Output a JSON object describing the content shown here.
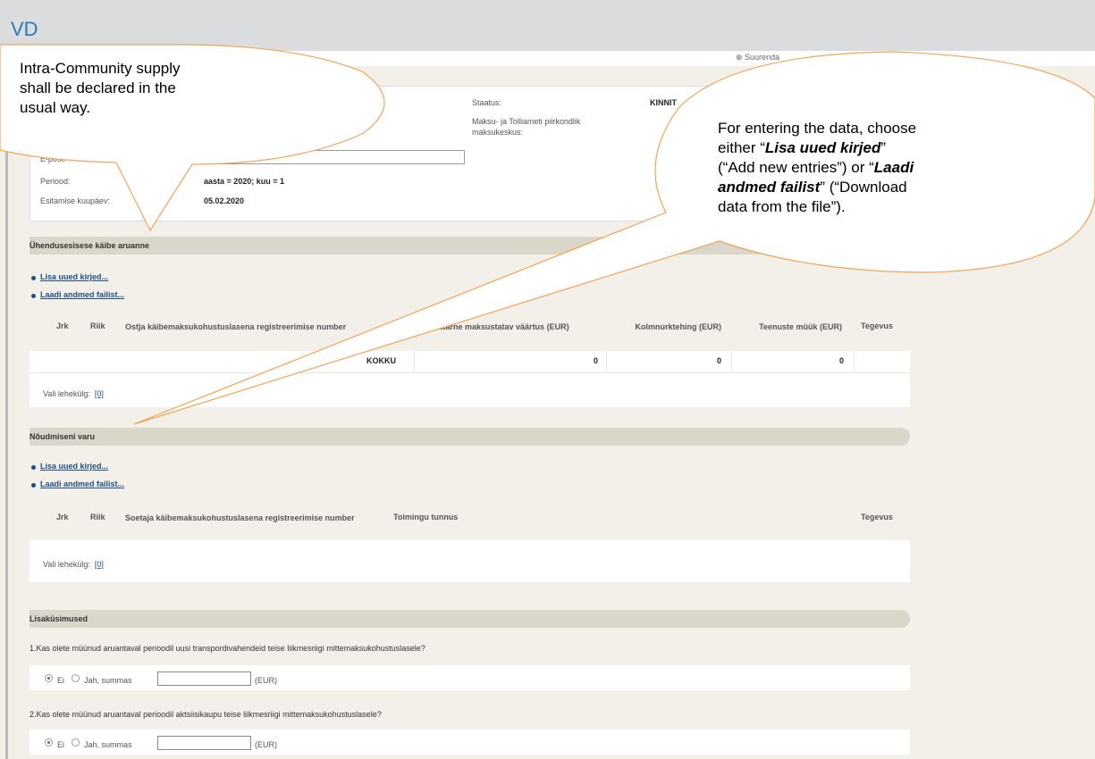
{
  "app": {
    "title": "VD",
    "zoom_label": "Suurenda"
  },
  "info": {
    "status_label": "Staatus:",
    "status_value": "KINNIT",
    "office_label": "Maksu- ja Tolliameti piirkondlik maksukeskus:",
    "email_label": "E-post:",
    "email_value": "",
    "period_label": "Periood:",
    "period_value": "aasta = 2020; kuu = 1",
    "date_label": "Esitamise kuupäev:",
    "date_value": "05.02.2020"
  },
  "section1": {
    "title": "Ühendusesisese käibe aruanne",
    "links": [
      "Lisa uued kirjed...",
      "Laadi andmed failist..."
    ],
    "columns": [
      "Jrk",
      "Riik",
      "Ostja käibemaksukohustuslasena registreerimise number",
      "Kaubatarne maksustatav väärtus (EUR)",
      "Kolmnurktehing (EUR)",
      "Teenuste müük (EUR)",
      "Tegevus"
    ],
    "total_label": "KOKKU",
    "totals": [
      "0",
      "0",
      "0"
    ],
    "pager_label": "Vali lehekülg:",
    "pager_value": "[0]"
  },
  "section2": {
    "title": "Nõudmiseni varu",
    "links": [
      "Lisa uued kirjed...",
      "Laadi andmed failist..."
    ],
    "columns": [
      "Jrk",
      "Riik",
      "Soetaja käibemaksukohustuslasena registreerimise number",
      "Toimingu tunnus",
      "Tegevus"
    ],
    "pager_label": "Vali lehekülg:",
    "pager_value": "[0]"
  },
  "section3": {
    "title": "Lisaküsimused",
    "q1": "1.Kas olete müünud aruantaval perioodil uusi transpordivahendeid teise liikmesriigi mittemaksukohustuslasele?",
    "q2": "2.Kas olete müünud aruantaval perioodil aktsiisikaupu teise liikmesriigi mittemaksukohustuslasele?",
    "opt_no": "Ei",
    "opt_yes": "Jah, summas",
    "unit": "(EUR)"
  },
  "callouts": {
    "left": [
      "Intra-Community supply",
      "shall be declared in the",
      "usual way."
    ],
    "right_1": "For entering the data, choose",
    "right_2a": "either “",
    "right_2b": "Lisa uued kirjed",
    "right_2c": "”",
    "right_3": "(“Add new entries”) or “",
    "right_3b": "Laadi",
    "right_4a": "andmed failist",
    "right_4b": "” (“Download",
    "right_5": "data from the file”)."
  }
}
